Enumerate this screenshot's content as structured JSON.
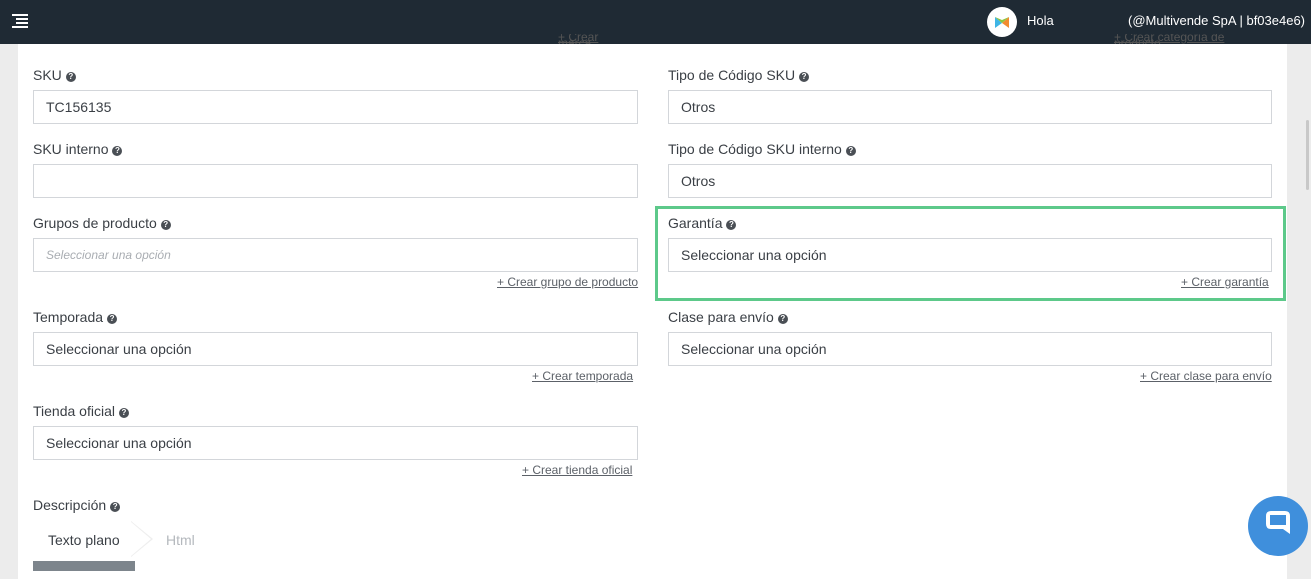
{
  "topbar": {
    "menu_icon": "menu-icon",
    "greeting": "Hola",
    "account": "(@Multivende SpA | bf03e4e6)",
    "account_chevron": "⌄"
  },
  "cut_links": {
    "left": "+ Crear marca",
    "right": "+ Crear categoría de producto"
  },
  "form": {
    "sku": {
      "label": "SKU",
      "value": "TC156135"
    },
    "sku_code_type": {
      "label": "Tipo de Código SKU",
      "value": "Otros"
    },
    "internal_sku": {
      "label": "SKU interno",
      "value": ""
    },
    "internal_sku_code_type": {
      "label": "Tipo de Código SKU interno",
      "value": "Otros"
    },
    "product_groups": {
      "label": "Grupos de producto",
      "placeholder": "Seleccionar una opción",
      "link": "+ Crear grupo de producto"
    },
    "warranty": {
      "label": "Garantía",
      "value": "Seleccionar una opción",
      "link": "+ Crear garantía"
    },
    "season": {
      "label": "Temporada",
      "value": "Seleccionar una opción",
      "link": "+ Crear temporada"
    },
    "shipping_class": {
      "label": "Clase para envío",
      "value": "Seleccionar una opción",
      "link": "+ Crear clase para envío"
    },
    "official_store": {
      "label": "Tienda oficial",
      "value": "Seleccionar una opción",
      "link": "+ Crear tienda oficial"
    },
    "description": {
      "label": "Descripción",
      "tabs": [
        {
          "label": "Texto plano"
        },
        {
          "label": "Html"
        }
      ]
    }
  },
  "help_glyph": "?",
  "colors": {
    "topbar": "#1f2a34",
    "highlight": "#5dc98a",
    "chat": "#3f8fdc"
  }
}
